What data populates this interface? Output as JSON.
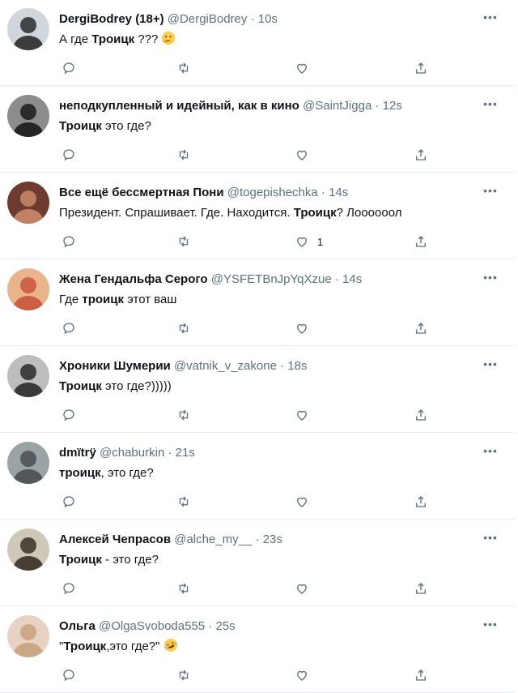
{
  "tweets": [
    {
      "name": "DergiBodrey (18+)",
      "handle": "@DergiBodrey",
      "time": "10s",
      "text_before": "А где ",
      "text_bold": "Троицк",
      "text_after": " ???",
      "emoji": "thinking-face",
      "likes": "",
      "avatar_colors": [
        "#cfd7dd",
        "#2b2b2b"
      ]
    },
    {
      "name": "неподкупленный и идейный, как в кино",
      "handle": "@SaintJigga",
      "time": "12s",
      "text_before": "",
      "text_bold": "Троицк",
      "text_after": " это где?",
      "emoji": "",
      "likes": "",
      "avatar_colors": [
        "#8c8c8c",
        "#1a1a1a"
      ]
    },
    {
      "name": "Все ещё бессмертная Пони",
      "handle": "@togepishechka",
      "time": "14s",
      "text_before": "Президент. Спрашивает. Где. Находится. ",
      "text_bold": "Троицк",
      "text_after": "? Лоооооол",
      "emoji": "",
      "likes": "1",
      "avatar_colors": [
        "#6e3b2f",
        "#c98a6a"
      ]
    },
    {
      "name": "Жена Гендальфа Серого",
      "handle": "@YSFETBnJpYqXzue",
      "time": "14s",
      "text_before": "Где ",
      "text_bold": "троицк",
      "text_after": " этот ваш",
      "emoji": "",
      "likes": "",
      "avatar_colors": [
        "#e9b48c",
        "#c9553a"
      ]
    },
    {
      "name": "Хроники Шумерии",
      "handle": "@vatnik_v_zakone",
      "time": "18s",
      "text_before": "",
      "text_bold": "Троицк",
      "text_after": " это где?)))))",
      "emoji": "",
      "likes": "",
      "avatar_colors": [
        "#bdbdbd",
        "#2a2a2a"
      ]
    },
    {
      "name": "dmïtrÿ",
      "handle": "@chaburkin",
      "time": "21s",
      "text_before": "",
      "text_bold": "троицк",
      "text_after": ", это где?",
      "emoji": "",
      "likes": "",
      "avatar_colors": [
        "#9aa3a6",
        "#4a4f52"
      ]
    },
    {
      "name": "Алексей Чепрасов",
      "handle": "@alche_my__",
      "time": "23s",
      "text_before": "",
      "text_bold": "Троицк",
      "text_after": " - это где?",
      "emoji": "",
      "likes": "",
      "avatar_colors": [
        "#cfc8b8",
        "#3a2f28"
      ]
    },
    {
      "name": "Ольга",
      "handle": "@OlgaSvoboda555",
      "time": "25s",
      "text_before": "\"",
      "text_bold": "Троицк",
      "text_after": ",это где?\"",
      "emoji": "rofl-face",
      "likes": "",
      "avatar_colors": [
        "#e8d2c4",
        "#c9a27e"
      ]
    }
  ]
}
